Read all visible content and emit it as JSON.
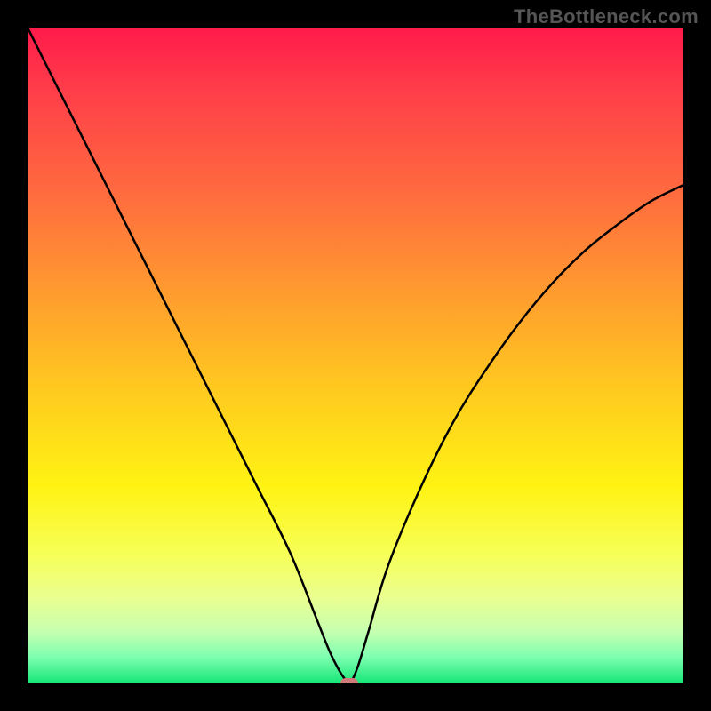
{
  "watermark": "TheBottleneck.com",
  "chart_data": {
    "type": "line",
    "title": "",
    "xlabel": "",
    "ylabel": "",
    "xlim": [
      0,
      100
    ],
    "ylim": [
      0,
      100
    ],
    "grid": false,
    "legend": false,
    "curve_color": "#000000",
    "curve_width": 2.5,
    "marker": {
      "x": 49,
      "y": 0,
      "color": "#d07a7a"
    },
    "series": [
      {
        "name": "bottleneck-curve",
        "x": [
          0,
          5,
          10,
          15,
          20,
          25,
          30,
          35,
          40,
          44,
          46,
          47.5,
          48.5,
          49,
          49.5,
          50.5,
          52,
          55,
          60,
          65,
          70,
          75,
          80,
          85,
          90,
          95,
          100
        ],
        "y": [
          100,
          90,
          80,
          70,
          60,
          50,
          40,
          30,
          20,
          10,
          5,
          2,
          0.5,
          0,
          0.5,
          3,
          8,
          18,
          30,
          40,
          48,
          55,
          61,
          66,
          70,
          73.5,
          76
        ]
      }
    ],
    "background_gradient": {
      "type": "vertical",
      "stops": [
        {
          "pos": 0.0,
          "color": "#ff1a4b"
        },
        {
          "pos": 0.1,
          "color": "#ff3f49"
        },
        {
          "pos": 0.25,
          "color": "#ff6a3f"
        },
        {
          "pos": 0.4,
          "color": "#ff9a2f"
        },
        {
          "pos": 0.55,
          "color": "#ffc91f"
        },
        {
          "pos": 0.7,
          "color": "#fff313"
        },
        {
          "pos": 0.8,
          "color": "#f7ff55"
        },
        {
          "pos": 0.87,
          "color": "#eaff90"
        },
        {
          "pos": 0.92,
          "color": "#c7ffb0"
        },
        {
          "pos": 0.96,
          "color": "#7dffb0"
        },
        {
          "pos": 1.0,
          "color": "#15e676"
        }
      ]
    }
  }
}
